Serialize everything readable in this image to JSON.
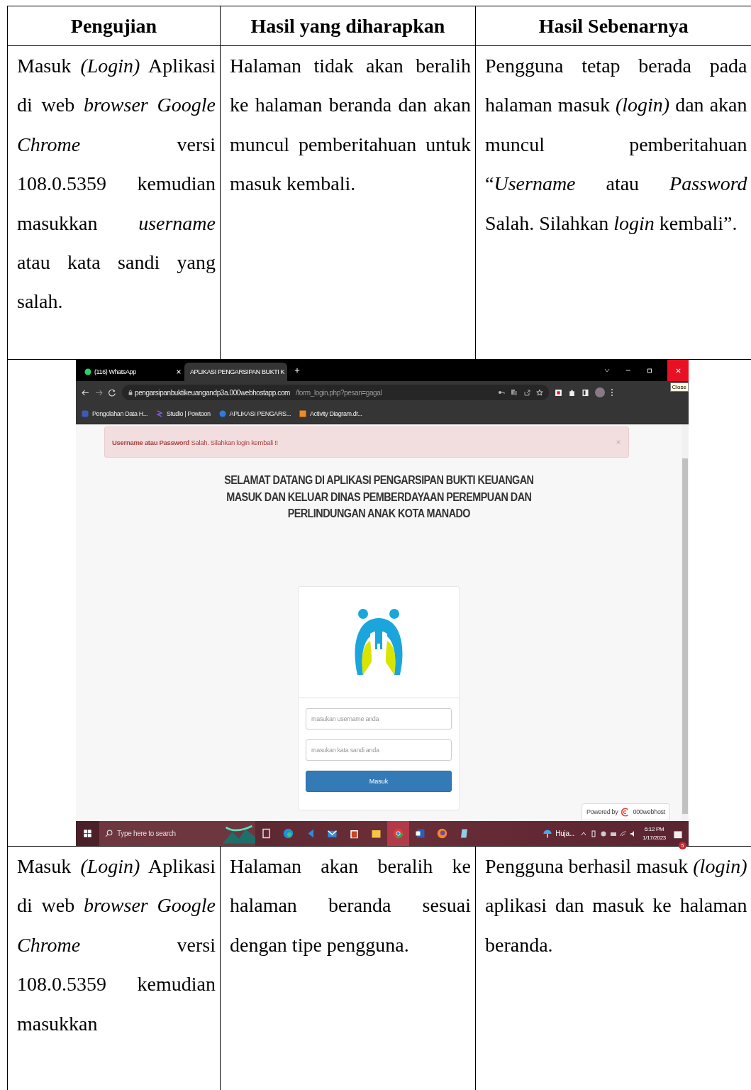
{
  "table": {
    "columns": [
      "Pengujian",
      "Hasil yang diharapkan",
      "Hasil Sebenarnya"
    ],
    "rows": [
      {
        "test": "Masuk *(Login)* Aplikasi di web *browser Google Chrome* versi 108.0.5359 kemudian masukkan *username* atau kata sandi yang salah.",
        "expected": "Halaman tidak akan beralih ke halaman beranda dan akan muncul pemberitahuan untuk masuk kembali.",
        "actual": "Pengguna tetap berada pada halaman masuk *(login)* dan akan muncul pemberitahuan “*Username* atau *Password* Salah. Silahkan *login* kembali”."
      },
      {
        "test": "Masuk *(Login)* Aplikasi di web *browser Google Chrome* versi 108.0.5359 kemudian masukkan",
        "expected": "Halaman akan beralih ke halaman beranda sesuai dengan tipe pengguna.",
        "actual": "Pengguna berhasil masuk *(login)* aplikasi dan masuk ke halaman beranda."
      }
    ]
  },
  "screenshot": {
    "tabs": [
      {
        "title": "(116) WhatsApp",
        "selected": false
      },
      {
        "title": "APLIKASI PENGARSIPAN BUKTI K",
        "selected": true
      }
    ],
    "tooltip": "Close",
    "url": {
      "host": "pengarsipanbuktikeuangandp3a.000webhostapp.com",
      "path": "/form_login.php?pesan=gagal"
    },
    "bookmarks": [
      "Pengolahan Data H...",
      "Studio | Powtoon",
      "APLIKASI PENGARS...",
      "Activity Diagram.dr..."
    ],
    "alert": "**Username atau Password** Salah. Silahkan login kembali !!",
    "heading": [
      "SELAMAT DATANG DI APLIKASI PENGARSIPAN BUKTI KEUANGAN",
      "MASUK DAN KELUAR DINAS PEMBERDAYAAN PEREMPUAN DAN",
      "PERLINDUNGAN ANAK KOTA MANADO"
    ],
    "login": {
      "username_placeholder": "masukan username anda",
      "password_placeholder": "masukan kata sandi anda",
      "button": "Masuk"
    },
    "powered_by": {
      "label": "Powered by",
      "brand": "000webhost"
    },
    "taskbar": {
      "search_placeholder": "Type here to search",
      "apps": [
        {
          "kind": "taskview",
          "selected": false
        },
        {
          "kind": "edge",
          "selected": false
        },
        {
          "kind": "code",
          "selected": false
        },
        {
          "kind": "mail",
          "selected": false
        },
        {
          "kind": "gift",
          "selected": false
        },
        {
          "kind": "folder",
          "selected": false
        },
        {
          "kind": "chrome",
          "selected": true
        },
        {
          "kind": "word",
          "selected": false
        },
        {
          "kind": "firefox",
          "selected": false
        },
        {
          "kind": "notepad",
          "selected": false
        }
      ],
      "weather": "Huja...",
      "time": "6:12 PM",
      "date": "1/17/2023",
      "notifications": "5"
    }
  }
}
